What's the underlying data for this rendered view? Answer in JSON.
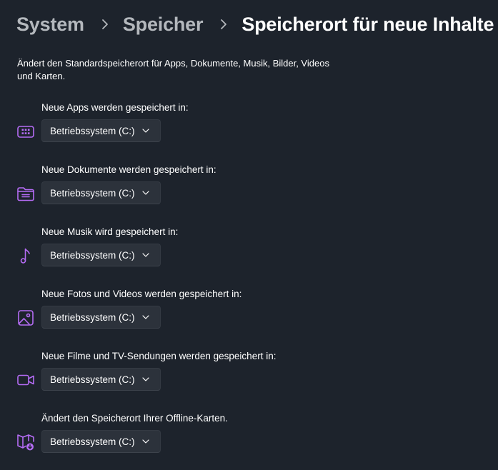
{
  "breadcrumb": {
    "items": [
      "System",
      "Speicher"
    ],
    "current": "Speicherort für neue Inhalte"
  },
  "description": "Ändert den Standardspeicherort für Apps, Dokumente, Musik, Bilder, Videos und Karten.",
  "settings": [
    {
      "label": "Neue Apps werden gespeichert in:",
      "icon": "apps-icon",
      "value": "Betriebssystem (C:)"
    },
    {
      "label": "Neue Dokumente werden gespeichert in:",
      "icon": "folder-icon",
      "value": "Betriebssystem (C:)"
    },
    {
      "label": "Neue Musik wird gespeichert in:",
      "icon": "music-note-icon",
      "value": "Betriebssystem (C:)"
    },
    {
      "label": "Neue Fotos und Videos werden gespeichert in:",
      "icon": "photo-icon",
      "value": "Betriebssystem (C:)"
    },
    {
      "label": "Neue Filme und TV-Sendungen werden gespeichert in:",
      "icon": "video-camera-icon",
      "value": "Betriebssystem (C:)"
    },
    {
      "label": "Ändert den Speicherort Ihrer Offline-Karten.",
      "icon": "map-download-icon",
      "value": "Betriebssystem (C:)"
    }
  ],
  "colors": {
    "background": "#1d232c",
    "dropdown": "#2c323b",
    "accent_icon": "#b56cf5",
    "muted_text": "#b4b8bd"
  }
}
